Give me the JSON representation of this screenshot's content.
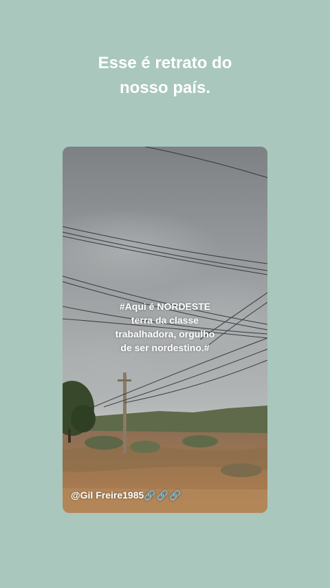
{
  "story": {
    "headline_line1": "Esse é retrato do",
    "headline_line2": "nosso país.",
    "background_color": "#a9c7bd"
  },
  "photo": {
    "caption_line1": "#Aqui é NORDESTE",
    "caption_line2": "terra da classe",
    "caption_line3": "trabalhadora, orgulho",
    "caption_line4": "de ser nordestino.#",
    "credit": "@Gil Freire1985",
    "credit_icons": "🔗🔗🔗"
  }
}
